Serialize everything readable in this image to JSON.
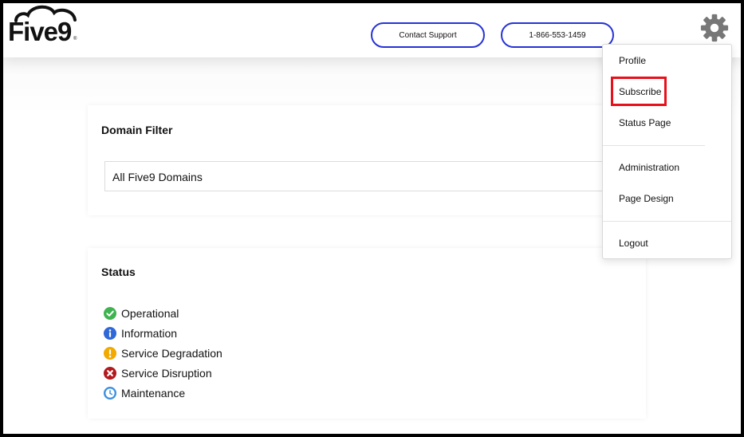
{
  "header": {
    "logo_text": "Five9",
    "logo_reg": "®",
    "contact_support_label": "Contact Support",
    "phone_label": "1-866-553-1459",
    "settings_icon": "gear-icon"
  },
  "domain_filter": {
    "title": "Domain Filter",
    "selected_value": "All Five9 Domains"
  },
  "status": {
    "title": "Status",
    "items": [
      {
        "label": "Operational",
        "icon": "check-circle-icon",
        "color": "#3fb34f"
      },
      {
        "label": "Information",
        "icon": "info-circle-icon",
        "color": "#2f68d8"
      },
      {
        "label": "Service Degradation",
        "icon": "exclamation-circle-icon",
        "color": "#f2a900"
      },
      {
        "label": "Service Disruption",
        "icon": "x-circle-icon",
        "color": "#b3191d"
      },
      {
        "label": "Maintenance",
        "icon": "clock-icon",
        "color": "#3d8fe0"
      }
    ]
  },
  "user_menu": {
    "items": [
      "Profile",
      "Subscribe",
      "Status Page",
      "Administration",
      "Page Design",
      "Logout"
    ],
    "highlighted_item": "Subscribe",
    "highlight_color": "#e8101a"
  },
  "colors": {
    "pill_border": "#2733d6",
    "gear": "#777777"
  }
}
